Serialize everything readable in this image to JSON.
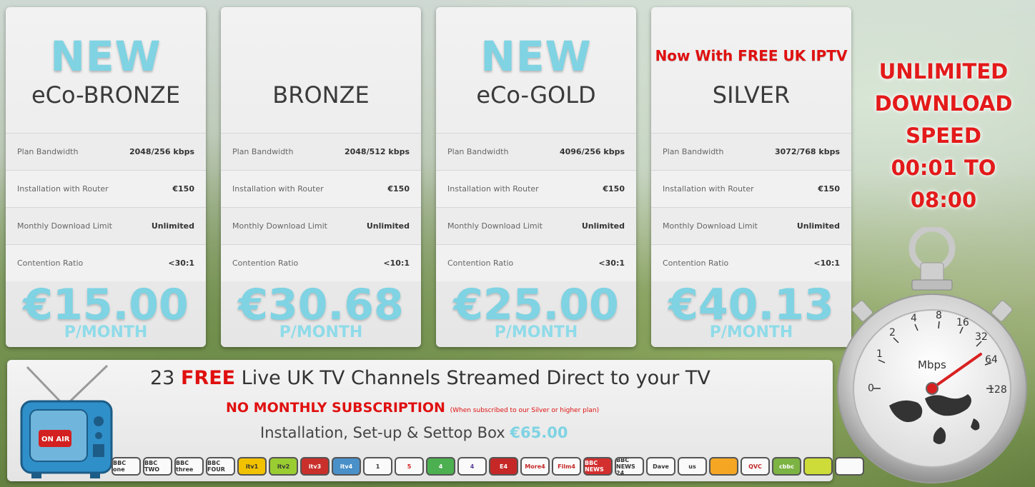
{
  "plans": [
    {
      "badge": "NEW",
      "iptv": "",
      "name": "eCo-BRONZE",
      "rows": [
        {
          "label": "Plan Bandwidth",
          "value": "2048/256 kbps"
        },
        {
          "label": "Installation with Router",
          "value": "€150"
        },
        {
          "label": "Monthly Download Limit",
          "value": "Unlimited"
        },
        {
          "label": "Contention Ratio",
          "value": "<30:1"
        }
      ],
      "price": "€15.00",
      "per": "P/MONTH"
    },
    {
      "badge": "",
      "iptv": "",
      "name": "BRONZE",
      "rows": [
        {
          "label": "Plan Bandwidth",
          "value": "2048/512 kbps"
        },
        {
          "label": "Installation with Router",
          "value": "€150"
        },
        {
          "label": "Monthly Download Limit",
          "value": "Unlimited"
        },
        {
          "label": "Contention Ratio",
          "value": "<10:1"
        }
      ],
      "price": "€30.68",
      "per": "P/MONTH"
    },
    {
      "badge": "NEW",
      "iptv": "",
      "name": "eCo-GOLD",
      "rows": [
        {
          "label": "Plan Bandwidth",
          "value": "4096/256 kbps"
        },
        {
          "label": "Installation with Router",
          "value": "€150"
        },
        {
          "label": "Monthly Download Limit",
          "value": "Unlimited"
        },
        {
          "label": "Contention Ratio",
          "value": "<30:1"
        }
      ],
      "price": "€25.00",
      "per": "P/MONTH"
    },
    {
      "badge": "",
      "iptv": "Now With FREE UK IPTV",
      "name": "SILVER",
      "rows": [
        {
          "label": "Plan Bandwidth",
          "value": "3072/768 kbps"
        },
        {
          "label": "Installation with Router",
          "value": "€150"
        },
        {
          "label": "Monthly Download Limit",
          "value": "Unlimited"
        },
        {
          "label": "Contention Ratio",
          "value": "<10:1"
        }
      ],
      "price": "€40.13",
      "per": "P/MONTH"
    }
  ],
  "promo": {
    "line1": "UNLIMITED",
    "line2": "DOWNLOAD",
    "line3": "SPEED",
    "line4": "00:01 TO 08:00"
  },
  "stopwatch": {
    "unit": "Mbps",
    "ticks": [
      "0",
      "1",
      "2",
      "4",
      "8",
      "16",
      "32",
      "64",
      "128"
    ]
  },
  "banner": {
    "headline_pre": "23 ",
    "headline_free": "FREE",
    "headline_post": " Live UK TV Channels Streamed Direct to your TV",
    "subscription": "NO MONTHLY SUBSCRIPTION",
    "subscription_note": "(When subscribed to our Silver or higher plan)",
    "install_text": "Installation, Set-up & Settop Box",
    "install_price": "€65.00",
    "tv_screen_top": "ON AIR",
    "tv_screen_label": "ON AIR"
  },
  "channels": [
    "BBC one",
    "BBC TWO",
    "BBC three",
    "BBC FOUR",
    "itv1",
    "itv2",
    "itv3",
    "itv4",
    "1",
    "5",
    "4",
    "4",
    "E4",
    "More4",
    "Film4",
    "BBC NEWS",
    "BBC NEWS 24",
    "Dave",
    "us",
    "",
    "QVC",
    "cbbc",
    "",
    ""
  ]
}
